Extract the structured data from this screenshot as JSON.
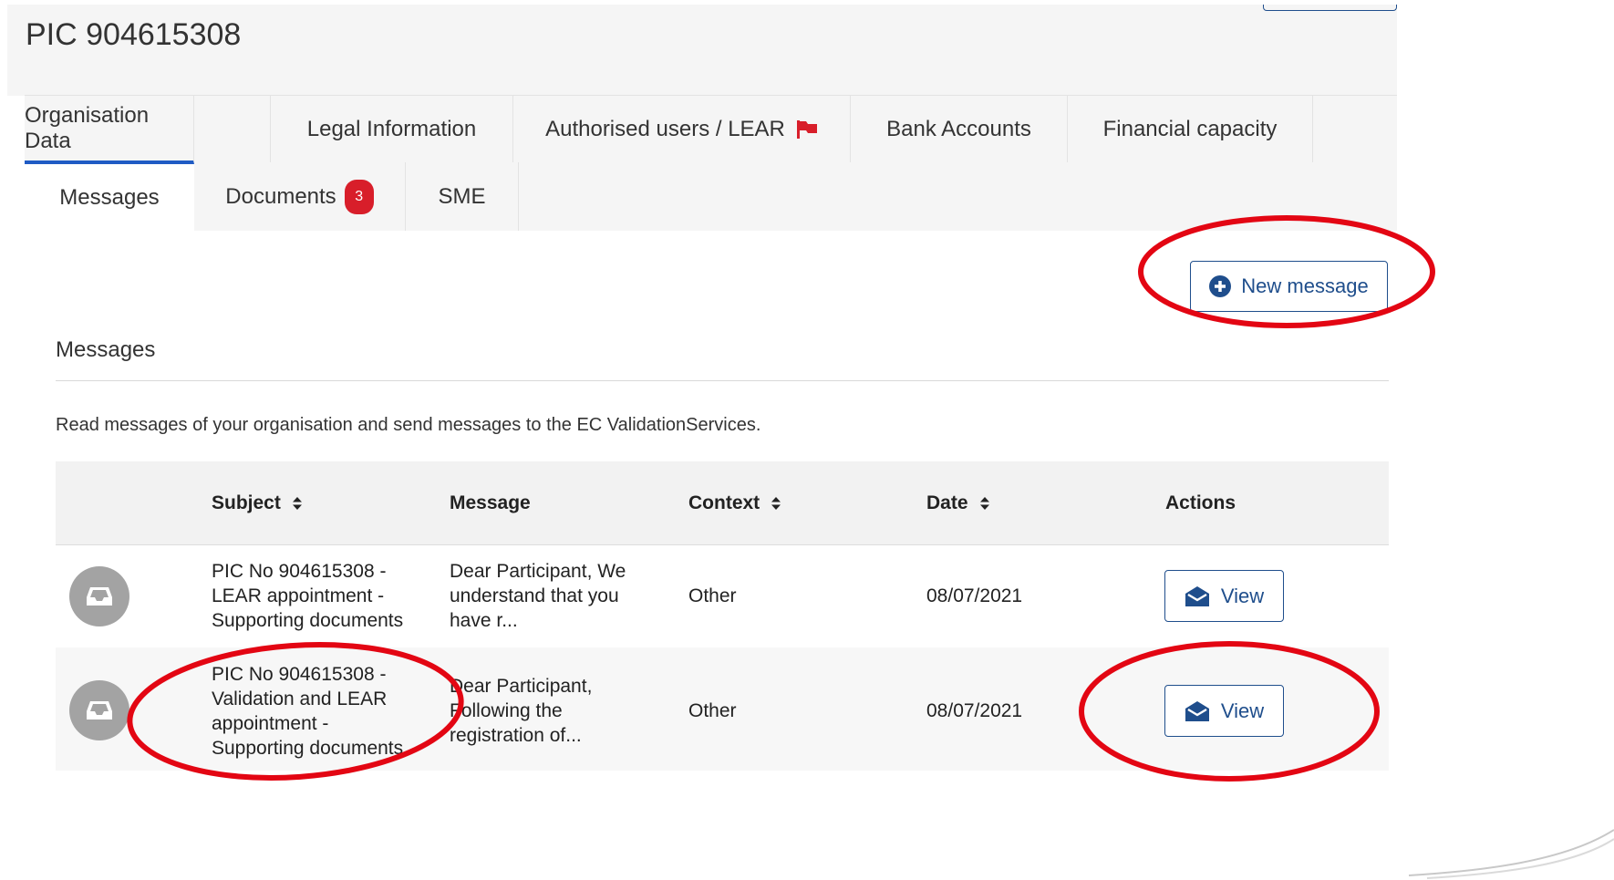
{
  "page": {
    "title": "PIC 904615308"
  },
  "tabs_row1": [
    {
      "label": "Organisation Data",
      "active": true
    },
    {
      "label": "Legal Information"
    },
    {
      "label": "Authorised users / LEAR",
      "icon": "red-flag-icon"
    },
    {
      "label": "Bank Accounts"
    },
    {
      "label": "Financial capacity"
    }
  ],
  "tabs_row2": [
    {
      "label": "Messages",
      "selected": true
    },
    {
      "label": "Documents",
      "badge": "3"
    },
    {
      "label": "SME"
    }
  ],
  "actions": {
    "new_message_label": "New message",
    "new_message_icon": "plus-circle-icon"
  },
  "section": {
    "title": "Messages",
    "description": "Read messages of your organisation and send messages to the EC ValidationServices."
  },
  "table": {
    "columns": [
      {
        "label": "Subject",
        "sortable": true
      },
      {
        "label": "Message",
        "sortable": false
      },
      {
        "label": "Context",
        "sortable": true
      },
      {
        "label": "Date",
        "sortable": true
      },
      {
        "label": "Actions",
        "sortable": false
      }
    ],
    "rows": [
      {
        "icon": "inbox-icon",
        "subject_lines": [
          "PIC No 904615308 -",
          "LEAR appointment -",
          "Supporting documents"
        ],
        "message_lines": [
          "Dear Participant, We",
          "understand that you",
          "have r..."
        ],
        "context": "Other",
        "date": "08/07/2021",
        "action_label": "View",
        "action_icon": "envelope-open-icon"
      },
      {
        "icon": "inbox-icon",
        "subject_lines": [
          "PIC No 904615308 -",
          "Validation and LEAR",
          "appointment -",
          "Supporting documents"
        ],
        "message_lines": [
          "Dear Participant,",
          "Following the",
          "registration of..."
        ],
        "context": "Other",
        "date": "08/07/2021",
        "action_label": "View",
        "action_icon": "envelope-open-icon"
      }
    ]
  },
  "colors": {
    "accent_blue": "#1f4e8c",
    "active_tab_underline": "#1f5bc4",
    "badge_red": "#d81e2a",
    "annotation_red": "#e30613",
    "tab_bar_bg": "#f5f5f5"
  }
}
